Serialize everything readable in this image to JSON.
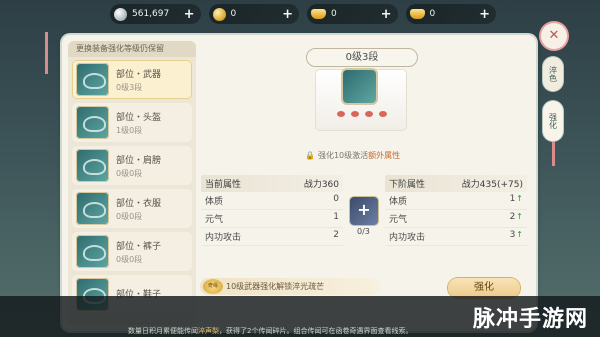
{
  "currencies": [
    {
      "icon": "silver-coin-icon",
      "value": "561,697"
    },
    {
      "icon": "gold-coin-icon",
      "value": "0"
    },
    {
      "icon": "gold-ingot-icon",
      "value": "0"
    },
    {
      "icon": "gold-ingot-icon",
      "value": "0"
    }
  ],
  "plus_symbol": "+",
  "left_panel": {
    "header": "更换装备强化等级仍保留",
    "slots": [
      {
        "name": "部位・武器",
        "level": "0级3段"
      },
      {
        "name": "部位・头盔",
        "level": "1级0段"
      },
      {
        "name": "部位・肩膀",
        "level": "0级0段"
      },
      {
        "name": "部位・衣服",
        "level": "0级0段"
      },
      {
        "name": "部位・裤子",
        "level": "0级0段"
      },
      {
        "name": "部位・鞋子",
        "level": ""
      }
    ]
  },
  "main": {
    "level_title": "0级3段",
    "unlock_text": "强化10级激活",
    "unlock_highlight": "额外属性",
    "current": {
      "title": "当前属性",
      "power": "战力360",
      "rows": [
        {
          "label": "体质",
          "value": "0"
        },
        {
          "label": "元气",
          "value": "1"
        },
        {
          "label": "内功攻击",
          "value": "2"
        }
      ]
    },
    "next": {
      "title": "下阶属性",
      "power": "战力435(+75)",
      "rows": [
        {
          "label": "体质",
          "value": "1"
        },
        {
          "label": "元气",
          "value": "2"
        },
        {
          "label": "内功攻击",
          "value": "3"
        }
      ]
    },
    "gem_symbol": "+",
    "gem_count": "0/3",
    "tip_badge": "奇缘",
    "tip_text": "10级武器强化解锁淬光疏芒",
    "strengthen_button": "强化"
  },
  "tabs": {
    "tab1": "淬色",
    "tab2": "强化"
  },
  "close_symbol": "✕",
  "ticker": {
    "pre": "数量日积月累便能传闻",
    "hl": "淬声梨",
    "post": "，获得了2个传闻碎片。组合传闻可在函卷奇遇界面查看线索。"
  },
  "watermark": "脉冲手游网",
  "colors": {
    "panel_bg": "#f6f3ea",
    "accent_gold": "#ecc98a",
    "highlight_orange": "#c76a2a",
    "up_arrow_green": "#3a8a3a"
  }
}
